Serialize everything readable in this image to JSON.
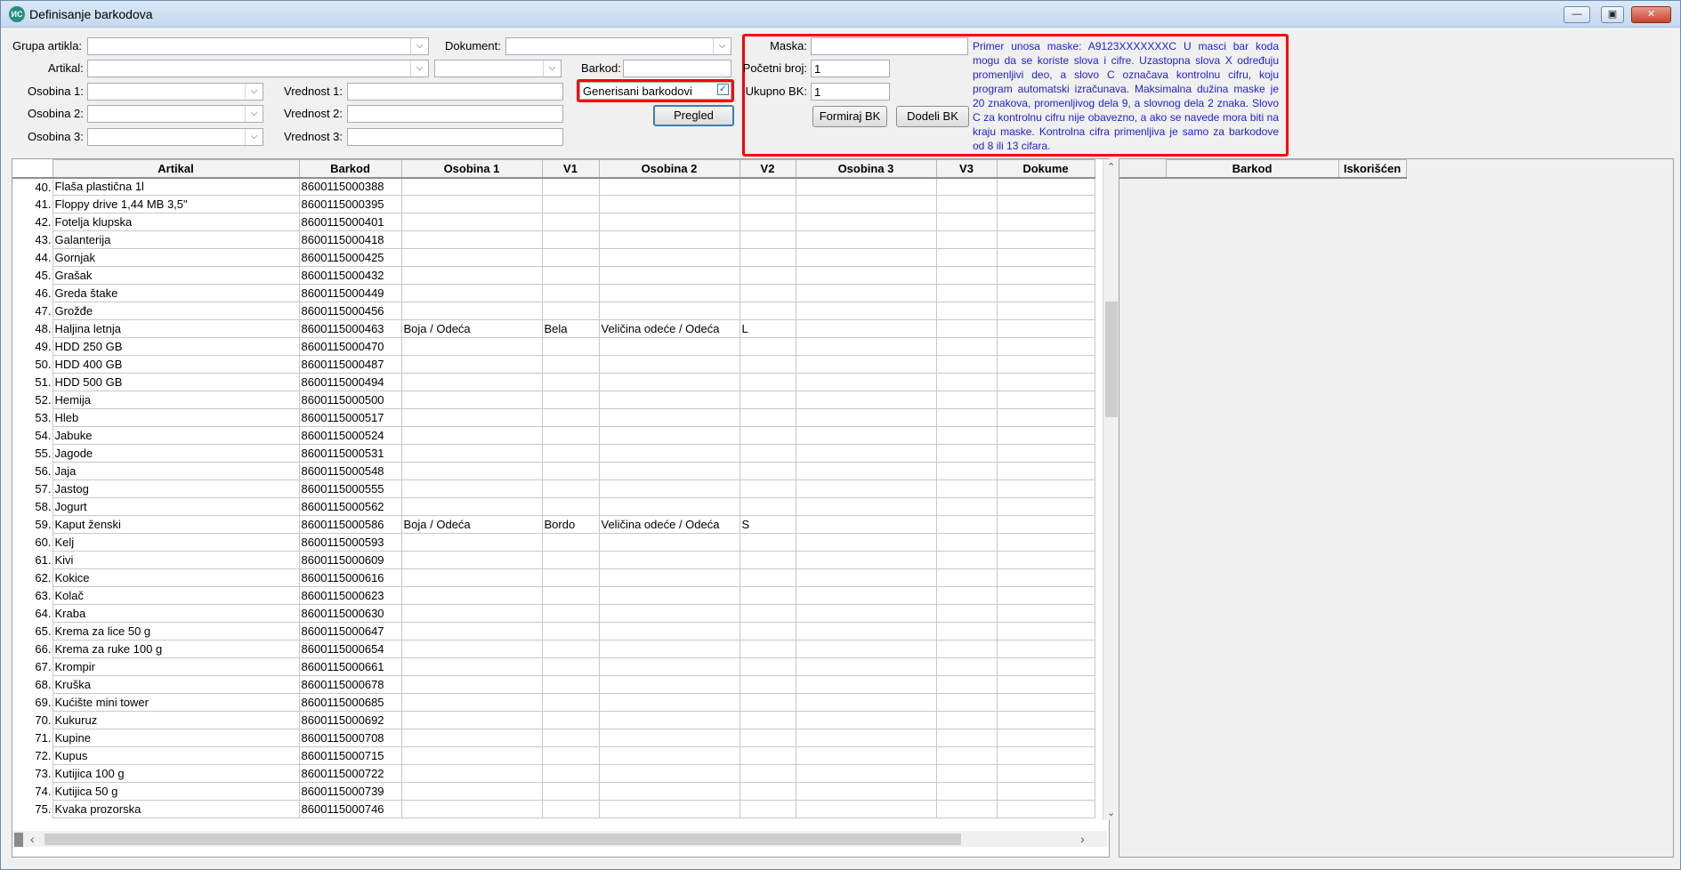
{
  "window": {
    "title": "Definisanje barkodova",
    "app_icon_text": "ИС",
    "minimize_icon": "minimize-icon",
    "maximize_icon": "maximize-icon",
    "close_icon": "close-icon",
    "minimize_glyph": "—",
    "maximize_glyph": "▣",
    "close_glyph": "✕"
  },
  "filters": {
    "grupa_artikla_label": "Grupa artikla:",
    "artikal_label": "Artikal:",
    "osobina1_label": "Osobina 1:",
    "osobina2_label": "Osobina 2:",
    "osobina3_label": "Osobina 3:",
    "vrednost1_label": "Vrednost 1:",
    "vrednost2_label": "Vrednost 2:",
    "vrednost3_label": "Vrednost 3:",
    "dokument_label": "Dokument:",
    "barkod_label": "Barkod:",
    "generisani_label": "Generisani barkodovi",
    "generisani_checked": true,
    "check_glyph": "✓",
    "dropdown_glyph": "⌵",
    "pregled_button": "Pregled"
  },
  "mask": {
    "maska_label": "Maska:",
    "maska_value": "",
    "pocetni_label": "Početni broj:",
    "pocetni_value": "1",
    "ukupno_label": "Ukupno BK:",
    "ukupno_value": "1",
    "formiraj_button": "Formiraj BK",
    "dodeli_button": "Dodeli BK",
    "help_text": "Primer unosa maske: A9123XXXXXXXC U masci bar koda mogu da se koriste slova i cifre. Uzastopna slova X određuju promenljivi deo, a slovo C označava kontrolnu cifru, koju program automatski izračunava. Maksimalna dužina maske je 20 znakova, promenljivog dela 9, a slovnog dela 2 znaka. Slovo C za kontrolnu cifru nije obavezno, a ako se navede mora biti na kraju maske. Kontrolna cifra primenljiva je samo za barkodove od 8 ili 13 cifara."
  },
  "grid": {
    "columns": [
      "",
      "Artikal",
      "Barkod",
      "Osobina 1",
      "V1",
      "Osobina 2",
      "V2",
      "Osobina 3",
      "V3",
      "Dokume"
    ],
    "rows": [
      [
        "40.",
        "Flaša plastična 1l",
        "8600115000388",
        "",
        "",
        "",
        "",
        "",
        "",
        ""
      ],
      [
        "41.",
        "Floppy drive 1,44 MB  3,5\"",
        "8600115000395",
        "",
        "",
        "",
        "",
        "",
        "",
        ""
      ],
      [
        "42.",
        "Fotelja klupska",
        "8600115000401",
        "",
        "",
        "",
        "",
        "",
        "",
        ""
      ],
      [
        "43.",
        "Galanterija",
        "8600115000418",
        "",
        "",
        "",
        "",
        "",
        "",
        ""
      ],
      [
        "44.",
        "Gornjak",
        "8600115000425",
        "",
        "",
        "",
        "",
        "",
        "",
        ""
      ],
      [
        "45.",
        "Grašak",
        "8600115000432",
        "",
        "",
        "",
        "",
        "",
        "",
        ""
      ],
      [
        "46.",
        "Greda štake",
        "8600115000449",
        "",
        "",
        "",
        "",
        "",
        "",
        ""
      ],
      [
        "47.",
        "Grožđe",
        "8600115000456",
        "",
        "",
        "",
        "",
        "",
        "",
        ""
      ],
      [
        "48.",
        "Haljina letnja",
        "8600115000463",
        "Boja / Odeća",
        "Bela",
        "Veličina odeće / Odeća",
        "L",
        "",
        "",
        ""
      ],
      [
        "49.",
        "HDD 250 GB",
        "8600115000470",
        "",
        "",
        "",
        "",
        "",
        "",
        ""
      ],
      [
        "50.",
        "HDD 400 GB",
        "8600115000487",
        "",
        "",
        "",
        "",
        "",
        "",
        ""
      ],
      [
        "51.",
        "HDD 500 GB",
        "8600115000494",
        "",
        "",
        "",
        "",
        "",
        "",
        ""
      ],
      [
        "52.",
        "Hemija",
        "8600115000500",
        "",
        "",
        "",
        "",
        "",
        "",
        ""
      ],
      [
        "53.",
        "Hleb",
        "8600115000517",
        "",
        "",
        "",
        "",
        "",
        "",
        ""
      ],
      [
        "54.",
        "Jabuke",
        "8600115000524",
        "",
        "",
        "",
        "",
        "",
        "",
        ""
      ],
      [
        "55.",
        "Jagode",
        "8600115000531",
        "",
        "",
        "",
        "",
        "",
        "",
        ""
      ],
      [
        "56.",
        "Jaja",
        "8600115000548",
        "",
        "",
        "",
        "",
        "",
        "",
        ""
      ],
      [
        "57.",
        "Jastog",
        "8600115000555",
        "",
        "",
        "",
        "",
        "",
        "",
        ""
      ],
      [
        "58.",
        "Jogurt",
        "8600115000562",
        "",
        "",
        "",
        "",
        "",
        "",
        ""
      ],
      [
        "59.",
        "Kaput ženski",
        "8600115000586",
        "Boja / Odeća",
        "Bordo",
        "Veličina odeće / Odeća",
        "S",
        "",
        "",
        ""
      ],
      [
        "60.",
        "Kelj",
        "8600115000593",
        "",
        "",
        "",
        "",
        "",
        "",
        ""
      ],
      [
        "61.",
        "Kivi",
        "8600115000609",
        "",
        "",
        "",
        "",
        "",
        "",
        ""
      ],
      [
        "62.",
        "Kokice",
        "8600115000616",
        "",
        "",
        "",
        "",
        "",
        "",
        ""
      ],
      [
        "63.",
        "Kolač",
        "8600115000623",
        "",
        "",
        "",
        "",
        "",
        "",
        ""
      ],
      [
        "64.",
        "Kraba",
        "8600115000630",
        "",
        "",
        "",
        "",
        "",
        "",
        ""
      ],
      [
        "65.",
        "Krema za lice 50 g",
        "8600115000647",
        "",
        "",
        "",
        "",
        "",
        "",
        ""
      ],
      [
        "66.",
        "Krema za ruke 100 g",
        "8600115000654",
        "",
        "",
        "",
        "",
        "",
        "",
        ""
      ],
      [
        "67.",
        "Krompir",
        "8600115000661",
        "",
        "",
        "",
        "",
        "",
        "",
        ""
      ],
      [
        "68.",
        "Kruška",
        "8600115000678",
        "",
        "",
        "",
        "",
        "",
        "",
        ""
      ],
      [
        "69.",
        "Kućište mini tower",
        "8600115000685",
        "",
        "",
        "",
        "",
        "",
        "",
        ""
      ],
      [
        "70.",
        "Kukuruz",
        "8600115000692",
        "",
        "",
        "",
        "",
        "",
        "",
        ""
      ],
      [
        "71.",
        "Kupine",
        "8600115000708",
        "",
        "",
        "",
        "",
        "",
        "",
        ""
      ],
      [
        "72.",
        "Kupus",
        "8600115000715",
        "",
        "",
        "",
        "",
        "",
        "",
        ""
      ],
      [
        "73.",
        "Kutijica 100 g",
        "8600115000722",
        "",
        "",
        "",
        "",
        "",
        "",
        ""
      ],
      [
        "74.",
        "Kutijica 50 g",
        "8600115000739",
        "",
        "",
        "",
        "",
        "",
        "",
        ""
      ],
      [
        "75.",
        "Kvaka prozorska",
        "8600115000746",
        "",
        "",
        "",
        "",
        "",
        "",
        ""
      ]
    ]
  },
  "grid2": {
    "columns": [
      "",
      "Barkod",
      "Iskorišćen"
    ]
  },
  "scroll": {
    "up_glyph": "⌃",
    "down_glyph": "⌄",
    "left_glyph": "‹",
    "right_glyph": "›"
  }
}
